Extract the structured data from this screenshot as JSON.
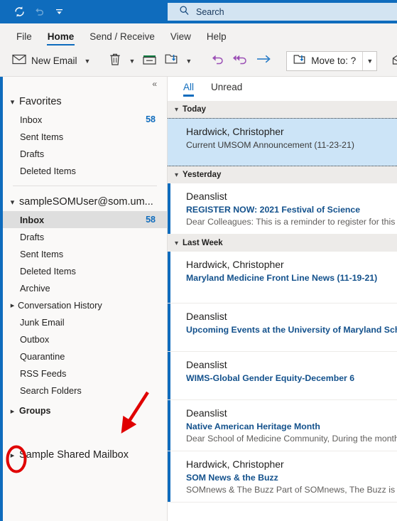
{
  "titlebar": {
    "quick_access": [
      {
        "name": "sync-icon",
        "label": "Send/Receive All Folders"
      },
      {
        "name": "undo-icon",
        "label": "Undo"
      },
      {
        "name": "customize-quick-access-icon",
        "label": "Customize Quick Access Toolbar"
      }
    ]
  },
  "search": {
    "placeholder": "Search",
    "value": "",
    "icon": "search-icon"
  },
  "ribbon": {
    "tabs": [
      {
        "label": "File",
        "active": false
      },
      {
        "label": "Home",
        "active": true
      },
      {
        "label": "Send / Receive",
        "active": false
      },
      {
        "label": "View",
        "active": false
      },
      {
        "label": "Help",
        "active": false
      }
    ],
    "new_email_label": "New Email",
    "move_to_label": "Move to: ?",
    "commands": [
      {
        "name": "new-email-button",
        "label": "New Email",
        "icon": "envelope-icon"
      },
      {
        "name": "delete-button",
        "label": "Delete",
        "icon": "trash-icon"
      },
      {
        "name": "archive-button",
        "label": "Archive",
        "icon": "archive-box-icon"
      },
      {
        "name": "move-button",
        "label": "Move",
        "icon": "move-to-folder-icon"
      },
      {
        "name": "reply-button",
        "label": "Reply",
        "icon": "reply-arrow-icon"
      },
      {
        "name": "reply-all-button",
        "label": "Reply All",
        "icon": "reply-all-arrow-icon"
      },
      {
        "name": "forward-button",
        "label": "Forward",
        "icon": "forward-arrow-icon"
      },
      {
        "name": "move-to-button",
        "label": "Move to: ?",
        "icon": "move-to-folder-icon"
      }
    ]
  },
  "sidebar": {
    "collapse_icon": "«",
    "favorites": {
      "title": "Favorites",
      "items": [
        {
          "label": "Inbox",
          "count": "58"
        },
        {
          "label": "Sent Items",
          "count": ""
        },
        {
          "label": "Drafts",
          "count": ""
        },
        {
          "label": "Deleted Items",
          "count": ""
        }
      ]
    },
    "account": {
      "title": "sampleSOMUser@som.um...",
      "items": [
        {
          "label": "Inbox",
          "count": "58",
          "selected": true,
          "expandable": false
        },
        {
          "label": "Drafts",
          "count": "",
          "selected": false,
          "expandable": false
        },
        {
          "label": "Sent Items",
          "count": "",
          "selected": false,
          "expandable": false
        },
        {
          "label": "Deleted Items",
          "count": "",
          "selected": false,
          "expandable": false
        },
        {
          "label": "Archive",
          "count": "",
          "selected": false,
          "expandable": false
        },
        {
          "label": "Conversation History",
          "count": "",
          "selected": false,
          "expandable": true
        },
        {
          "label": "Junk Email",
          "count": "",
          "selected": false,
          "expandable": false
        },
        {
          "label": "Outbox",
          "count": "",
          "selected": false,
          "expandable": false
        },
        {
          "label": "Quarantine",
          "count": "",
          "selected": false,
          "expandable": false
        },
        {
          "label": "RSS Feeds",
          "count": "",
          "selected": false,
          "expandable": false
        },
        {
          "label": "Search Folders",
          "count": "",
          "selected": false,
          "expandable": false
        }
      ]
    },
    "groups": {
      "label": "Groups"
    },
    "shared_mailbox": {
      "label": "Sample Shared Mailbox"
    }
  },
  "list": {
    "filters": [
      {
        "label": "All",
        "active": true
      },
      {
        "label": "Unread",
        "active": false
      }
    ],
    "groups": [
      {
        "label": "Today",
        "messages": [
          {
            "sender": "Hardwick, Christopher",
            "subject": "Current UMSOM Announcement (11-23-21)",
            "preview": "",
            "selected": true,
            "unread": false,
            "subject_bold": false
          }
        ]
      },
      {
        "label": "Yesterday",
        "messages": [
          {
            "sender": "Deanslist",
            "subject": "REGISTER NOW: 2021 Festival of Science",
            "preview": "Dear Colleagues:  This is a reminder to register for this yea",
            "selected": false,
            "unread": true,
            "subject_bold": true
          }
        ]
      },
      {
        "label": "Last Week",
        "messages": [
          {
            "sender": "Hardwick, Christopher",
            "subject": "Maryland Medicine Front Line News (11-19-21)",
            "preview": "",
            "selected": false,
            "unread": true,
            "subject_bold": true
          },
          {
            "sender": "Deanslist",
            "subject": "Upcoming Events at the University of Maryland School of",
            "preview": "",
            "selected": false,
            "unread": true,
            "subject_bold": true
          },
          {
            "sender": "Deanslist",
            "subject": "WIMS-Global Gender Equity-December 6",
            "preview": "",
            "selected": false,
            "unread": true,
            "subject_bold": true
          },
          {
            "sender": "Deanslist",
            "subject": "Native American Heritage Month",
            "preview": "Dear School of Medicine Community,  During the month o",
            "selected": false,
            "unread": true,
            "subject_bold": true
          },
          {
            "sender": "Hardwick, Christopher",
            "subject": "SOM News & the Buzz",
            "preview": "SOMnews & The Buzz  Part of SOMnews, The Buzz is a",
            "selected": false,
            "unread": true,
            "subject_bold": true
          }
        ]
      }
    ]
  },
  "annotations": {
    "color": "#E00000",
    "ellipse": {
      "name": "highlight-ellipse",
      "target": "expand-shared-mailbox-chevron"
    },
    "arrow": {
      "name": "pointer-arrow",
      "target": "expand-shared-mailbox-chevron"
    }
  },
  "colors": {
    "accent": "#0F6CBD",
    "titlebar": "#0F6CBD",
    "ribbon_bg": "#F3F2F1",
    "sidebar_bg": "#FAF9F8",
    "selected_row": "#CCE4F7",
    "subject_link": "#13518C",
    "annotation_red": "#E00000"
  }
}
